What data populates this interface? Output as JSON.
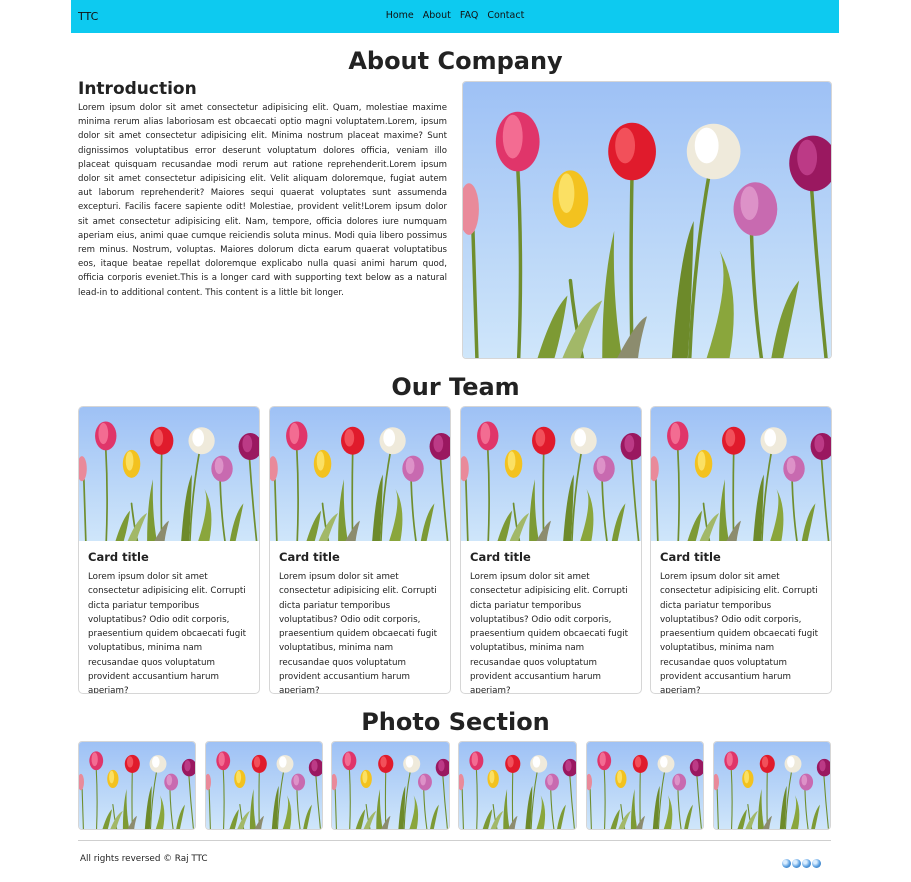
{
  "navbar": {
    "brand": "TTC",
    "links": [
      "Home",
      "About",
      "FAQ",
      "Contact"
    ]
  },
  "about": {
    "heading": "About Company",
    "intro_title": "Introduction",
    "intro_text": "Lorem ipsum dolor sit amet consectetur adipisicing elit. Quam, molestiae maxime minima rerum alias laboriosam est obcaecati optio magni voluptatem.Lorem, ipsum dolor sit amet consectetur adipisicing elit. Minima nostrum placeat maxime? Sunt dignissimos voluptatibus error deserunt voluptatum dolores officia, veniam illo placeat quisquam recusandae modi rerum aut ratione reprehenderit.Lorem ipsum dolor sit amet consectetur adipisicing elit. Velit aliquam doloremque, fugiat autem aut laborum reprehenderit? Maiores sequi quaerat voluptates sunt assumenda excepturi. Facilis facere sapiente odit! Molestiae, provident velit!Lorem ipsum dolor sit amet consectetur adipisicing elit. Nam, tempore, officia dolores iure numquam aperiam eius, animi quae cumque reiciendis soluta minus. Modi quia libero possimus rem minus. Nostrum, voluptas. Maiores dolorum dicta earum quaerat voluptatibus eos, itaque beatae repellat doloremque explicabo nulla quasi animi harum quod, officia corporis eveniet.This is a longer card with supporting text below as a natural lead-in to additional content. This content is a little bit longer."
  },
  "team": {
    "heading": "Our Team",
    "cards": [
      {
        "title": "Card title",
        "text": "Lorem ipsum dolor sit amet consectetur adipisicing elit. Corrupti dicta pariatur temporibus voluptatibus? Odio odit corporis, praesentium quidem obcaecati fugit voluptatibus, minima nam recusandae quos voluptatum provident accusantium harum aperiam?"
      },
      {
        "title": "Card title",
        "text": "Lorem ipsum dolor sit amet consectetur adipisicing elit. Corrupti dicta pariatur temporibus voluptatibus? Odio odit corporis, praesentium quidem obcaecati fugit voluptatibus, minima nam recusandae quos voluptatum provident accusantium harum aperiam?"
      },
      {
        "title": "Card title",
        "text": "Lorem ipsum dolor sit amet consectetur adipisicing elit. Corrupti dicta pariatur temporibus voluptatibus? Odio odit corporis, praesentium quidem obcaecati fugit voluptatibus, minima nam recusandae quos voluptatum provident accusantium harum aperiam?"
      },
      {
        "title": "Card title",
        "text": "Lorem ipsum dolor sit amet consectetur adipisicing elit. Corrupti dicta pariatur temporibus voluptatibus? Odio odit corporis, praesentium quidem obcaecati fugit voluptatibus, minima nam recusandae quos voluptatum provident accusantium harum aperiam?"
      }
    ]
  },
  "photos": {
    "heading": "Photo Section",
    "count": 6
  },
  "footer": {
    "copyright": "All rights reversed © Raj TTC",
    "social_icons": [
      "globe-icon",
      "globe-icon",
      "globe-icon",
      "globe-icon"
    ]
  },
  "colors": {
    "navbar_bg": "#0dcaf0",
    "sky_top": "#9ec1f5",
    "sky_bottom": "#cfe6fa"
  }
}
